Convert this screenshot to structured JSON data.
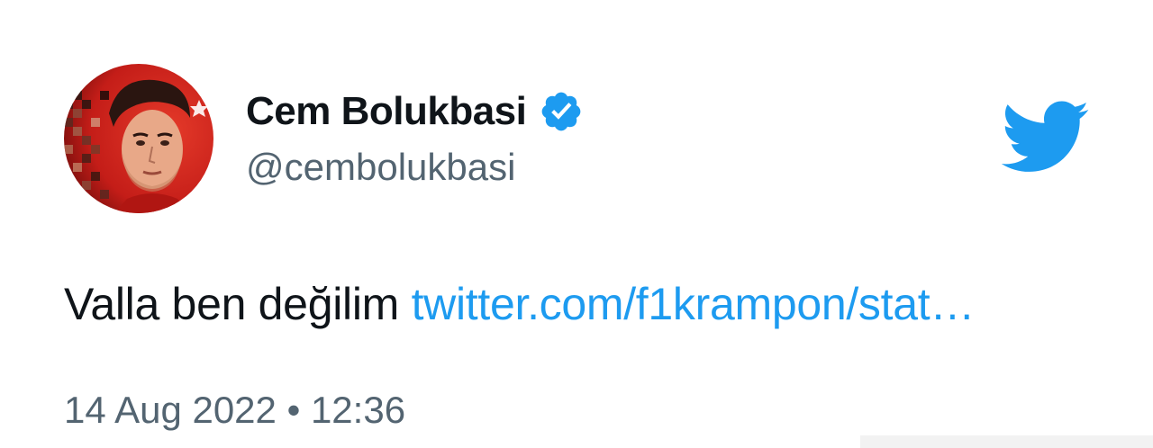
{
  "tweet": {
    "author_name": "Cem Bolukbasi",
    "author_handle": "@cembolukbasi",
    "text": "Valla ben değilim",
    "link_text": "twitter.com/f1krampon/stat…",
    "timestamp": "14 Aug 2022 • 12:36"
  },
  "icons": {
    "verified": "verified-badge-icon",
    "brand": "twitter-bird-icon"
  },
  "colors": {
    "brand_blue": "#1d9bf0",
    "text_primary": "#0f1419",
    "text_secondary": "#536471",
    "avatar_background": "#d8231f"
  }
}
